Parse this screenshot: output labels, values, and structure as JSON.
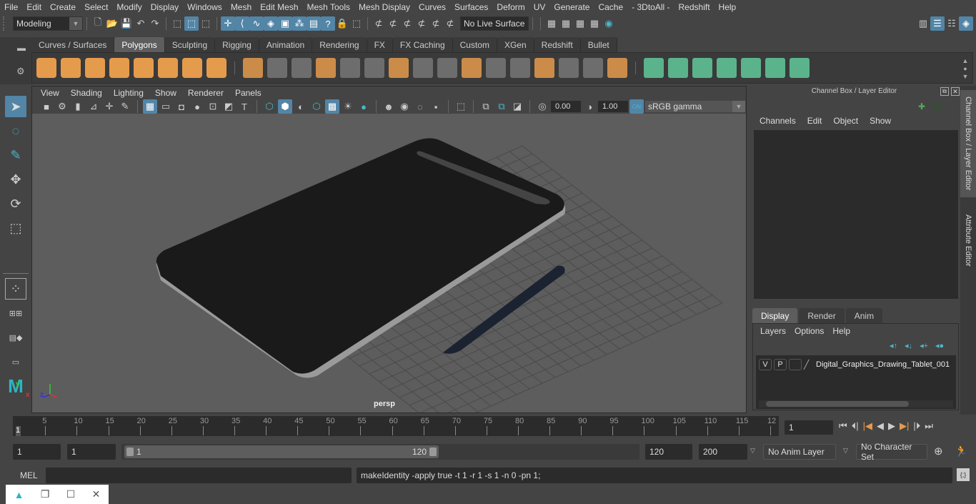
{
  "menubar": [
    "File",
    "Edit",
    "Create",
    "Select",
    "Modify",
    "Display",
    "Windows",
    "Mesh",
    "Edit Mesh",
    "Mesh Tools",
    "Mesh Display",
    "Curves",
    "Surfaces",
    "Deform",
    "UV",
    "Generate",
    "Cache",
    "- 3DtoAll -",
    "Redshift",
    "Help"
  ],
  "status_line": {
    "mode": "Modeling",
    "live_surface": "No Live Surface"
  },
  "shelf": {
    "tabs": [
      "Curves / Surfaces",
      "Polygons",
      "Sculpting",
      "Rigging",
      "Animation",
      "Rendering",
      "FX",
      "FX Caching",
      "Custom",
      "XGen",
      "Redshift",
      "Bullet"
    ],
    "active_tab": "Polygons",
    "orange_icons": [
      "poly-sphere",
      "poly-cube",
      "poly-cylinder",
      "poly-cone",
      "poly-plane",
      "poly-torus",
      "poly-pyramid",
      "poly-pipe"
    ],
    "edit_icons": [
      "combine",
      "separate",
      "mirror",
      "smooth",
      "bevel-cube",
      "extract",
      "multi-cut",
      "extrude",
      "bridge",
      "append",
      "insert-edge-loop",
      "offset-edge-loop",
      "bevel",
      "target-weld",
      "fill-hole",
      "merge"
    ],
    "uv_icons": [
      "planar-uv",
      "cylindrical-uv",
      "spherical-uv",
      "automatic-uv",
      "unfold-uv",
      "uv-editor",
      "layout-uv"
    ]
  },
  "viewport": {
    "menu": [
      "View",
      "Shading",
      "Lighting",
      "Show",
      "Renderer",
      "Panels"
    ],
    "exposure": "0.00",
    "gamma": "1.00",
    "color_space": "sRGB gamma",
    "camera_label": "persp",
    "axis": {
      "x": "x",
      "y": "y",
      "z": "z"
    }
  },
  "channel_box": {
    "title": "Channel Box / Layer Editor",
    "menu": [
      "Channels",
      "Edit",
      "Object",
      "Show"
    ]
  },
  "layer_editor": {
    "tabs": [
      "Display",
      "Render",
      "Anim"
    ],
    "active_tab": "Display",
    "menu": [
      "Layers",
      "Options",
      "Help"
    ],
    "layers": [
      {
        "v": "V",
        "p": "P",
        "name": "Digital_Graphics_Drawing_Tablet_001"
      }
    ]
  },
  "side_tabs": [
    "Channel Box / Layer Editor",
    "Attribute Editor"
  ],
  "timeline": {
    "start_label": "1",
    "ticks": [
      "5",
      "10",
      "15",
      "20",
      "25",
      "30",
      "35",
      "40",
      "45",
      "50",
      "55",
      "60",
      "65",
      "70",
      "75",
      "80",
      "85",
      "90",
      "95",
      "100",
      "105",
      "110",
      "115",
      "12"
    ],
    "current_frame": "1"
  },
  "range": {
    "start": "1",
    "anim_start": "1",
    "slider_min": "1",
    "slider_max": "120",
    "end": "120",
    "anim_end": "200",
    "anim_layer": "No Anim Layer",
    "character_set": "No Character Set"
  },
  "command_line": {
    "label": "MEL",
    "input": "",
    "output": "makeIdentity -apply true -t 1 -r 1 -s 1 -n 0 -pn 1;"
  }
}
